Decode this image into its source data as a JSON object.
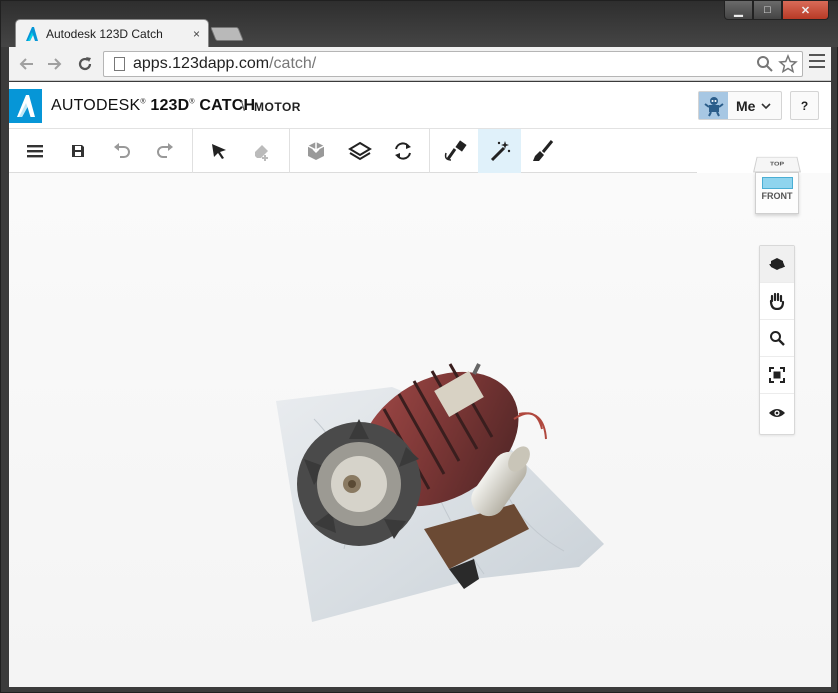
{
  "browser": {
    "tab_title": "Autodesk 123D Catch",
    "tab_close": "×",
    "url_host": "apps.123dapp.com",
    "url_path": "/catch/",
    "window_controls": {
      "minimize": "▁",
      "maximize": "□",
      "close": "✕"
    }
  },
  "app": {
    "brand_prefix": "AUTODESK",
    "brand_mark": "®",
    "brand_product": "123D",
    "brand_product_mark": "®",
    "brand_suffix": "CATCH",
    "crumb_separator": "\\",
    "project_name": "MOTOR",
    "user_label": "Me",
    "help_label": "?",
    "accent_color": "#0696d7"
  },
  "toolbar": {
    "tools": [
      {
        "name": "menu-icon",
        "active": false
      },
      {
        "name": "save-icon",
        "active": false
      },
      {
        "name": "undo-icon",
        "active": false
      },
      {
        "name": "redo-icon",
        "active": false
      },
      {
        "name": "select-arrow-icon",
        "active": false
      },
      {
        "name": "eraser-icon",
        "active": false
      },
      {
        "name": "cube-box-icon",
        "active": false
      },
      {
        "name": "layers-icon",
        "active": false
      },
      {
        "name": "refresh-icon",
        "active": false
      },
      {
        "name": "lasso-brush-icon",
        "active": false
      },
      {
        "name": "magic-wand-icon",
        "active": true
      },
      {
        "name": "paint-brush-icon",
        "active": false
      }
    ]
  },
  "viewcube": {
    "top_label": "TOP",
    "front_label": "FRONT"
  },
  "navbar": {
    "items": [
      {
        "name": "orbit-icon",
        "active": true
      },
      {
        "name": "pan-hand-icon",
        "active": false
      },
      {
        "name": "zoom-icon",
        "active": false
      },
      {
        "name": "fit-to-view-icon",
        "active": false
      },
      {
        "name": "eye-icon",
        "active": false
      }
    ]
  }
}
